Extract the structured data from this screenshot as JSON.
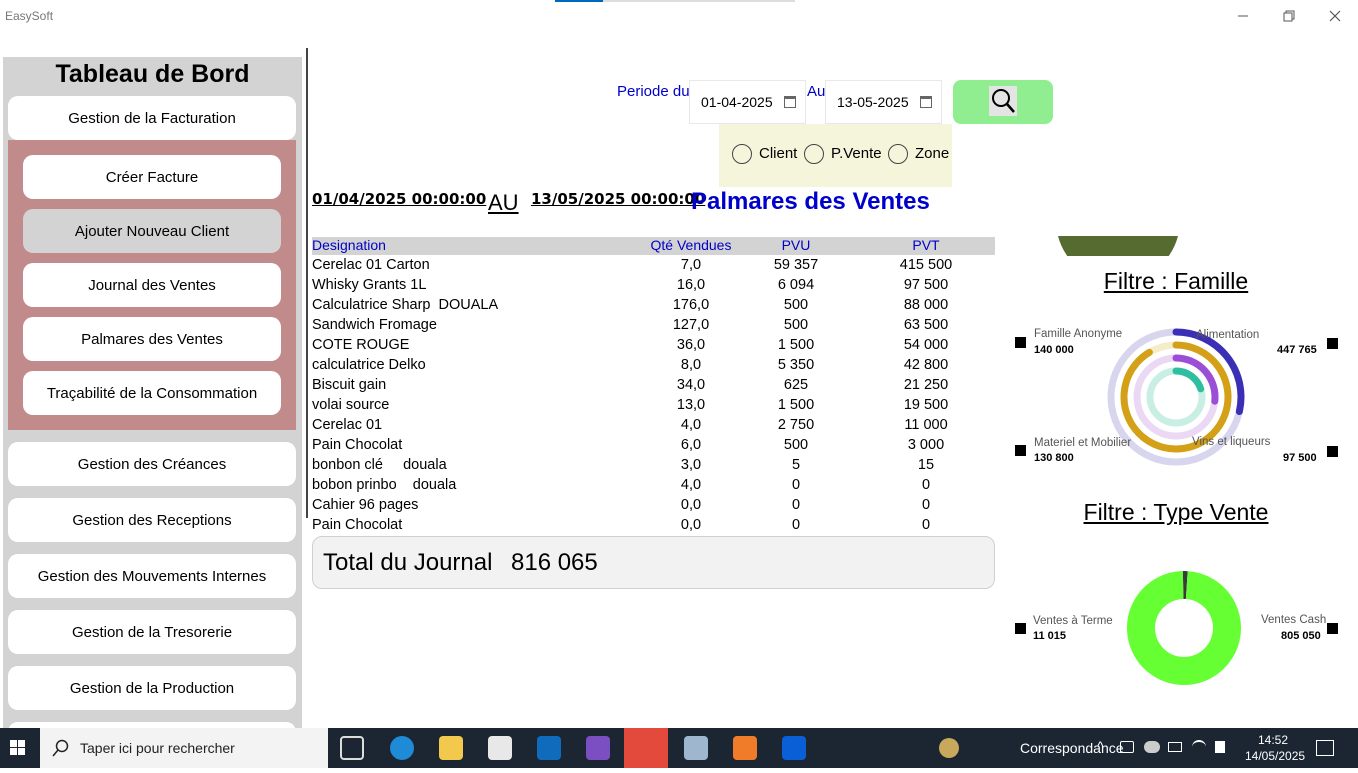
{
  "window": {
    "title": "EasySoft",
    "minimize_icon": "minimize-icon",
    "maximize_icon": "restore-icon",
    "close_icon": "close-icon"
  },
  "sidebar": {
    "title": "Tableau de Bord",
    "facturation": "Gestion de la Facturation",
    "sub_items": [
      "Créer Facture",
      "Ajouter Nouveau Client",
      "Journal des Ventes",
      "Palmares des Ventes",
      "Traçabilité de la Consommation"
    ],
    "items": [
      "Gestion des Créances",
      "Gestion des Receptions",
      "Gestion des Mouvements Internes",
      "Gestion de la Tresorerie",
      "Gestion de la Production"
    ]
  },
  "filters": {
    "periode_label": "Periode du",
    "au_label": "Au",
    "date_from": "01-04-2025",
    "date_to": "13-05-2025",
    "radios": [
      "Client",
      "P.Vente",
      "Zone"
    ]
  },
  "report": {
    "date_from": "01/04/2025 00:00:00",
    "au": "AU",
    "date_to": "13/05/2025 00:00:00",
    "title": "Palmares des Ventes"
  },
  "table": {
    "headers": [
      "Designation",
      "Qté Vendues",
      "PVU",
      "PVT"
    ],
    "rows": [
      [
        "Cerelac 01 Carton",
        "7,0",
        "59 357",
        "415 500"
      ],
      [
        "Whisky Grants 1L",
        "16,0",
        "6 094",
        "97 500"
      ],
      [
        "Calculatrice Sharp  DOUALA",
        "176,0",
        "500",
        "88 000"
      ],
      [
        "Sandwich Fromage",
        "127,0",
        "500",
        "63 500"
      ],
      [
        "COTE ROUGE",
        "36,0",
        "1 500",
        "54 000"
      ],
      [
        "calculatrice Delko",
        "8,0",
        "5 350",
        "42 800"
      ],
      [
        "Biscuit gain",
        "34,0",
        "625",
        "21 250"
      ],
      [
        "volai source",
        "13,0",
        "1 500",
        "19 500"
      ],
      [
        "Cerelac 01",
        "4,0",
        "2 750",
        "11 000"
      ],
      [
        "Pain Chocolat",
        "6,0",
        "500",
        "3 000"
      ],
      [
        "bonbon clé     douala",
        "3,0",
        "5",
        "15"
      ],
      [
        "bobon prinbo    douala",
        "4,0",
        "0",
        "0"
      ],
      [
        "Cahier 96 pages",
        "0,0",
        "0",
        "0"
      ],
      [
        "Pain Chocolat",
        "0,0",
        "0",
        "0"
      ]
    ]
  },
  "total": {
    "label": "Total du Journal",
    "value": "816 065"
  },
  "chart_famille": {
    "title": "Filtre : Famille",
    "legend": [
      {
        "name": "Famille Anonyme",
        "value": "140 000"
      },
      {
        "name": "Alimentation",
        "value": "447 765"
      },
      {
        "name": "Materiel et Mobilier",
        "value": "130 800"
      },
      {
        "name": "Vins et liqueurs",
        "value": "97 500"
      }
    ]
  },
  "chart_type_vente": {
    "title": "Filtre : Type Vente",
    "legend": [
      {
        "name": "Ventes à Terme",
        "value": "11 015"
      },
      {
        "name": "Ventes Cash",
        "value": "805 050"
      }
    ]
  },
  "chart_data": [
    {
      "type": "pie",
      "title": "Filtre : Famille",
      "categories": [
        "Famille Anonyme",
        "Alimentation",
        "Materiel et Mobilier",
        "Vins et liqueurs"
      ],
      "values": [
        140000,
        447765,
        130800,
        97500
      ],
      "colors": [
        "#3b2fb5",
        "#d4a017",
        "#9b4fd6",
        "#2fbfa0"
      ]
    },
    {
      "type": "pie",
      "title": "Filtre : Type Vente",
      "categories": [
        "Ventes à Terme",
        "Ventes Cash"
      ],
      "values": [
        11015,
        805050
      ],
      "colors": [
        "#3a3a3a",
        "#66ff33"
      ]
    }
  ],
  "taskbar": {
    "search_placeholder": "Taper ici pour rechercher",
    "weather": "Correspondance",
    "time": "14:52",
    "date": "14/05/2025"
  }
}
